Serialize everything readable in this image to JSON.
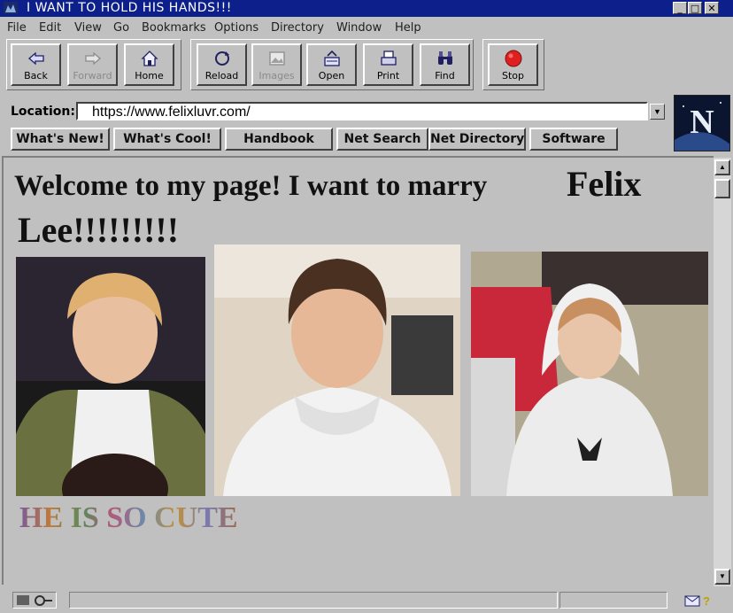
{
  "window": {
    "title": "I WANT TO HOLD HIS HANDS!!!",
    "controls": {
      "minimize": "_",
      "maximize": "□",
      "close": "✕"
    }
  },
  "menu": [
    "File",
    "Edit",
    "View",
    "Go",
    "Bookmarks",
    "Options",
    "Directory",
    "Window",
    "Help"
  ],
  "toolbar": {
    "back": "Back",
    "forward": "Forward",
    "home": "Home",
    "reload": "Reload",
    "images": "Images",
    "open": "Open",
    "print": "Print",
    "find": "Find",
    "stop": "Stop"
  },
  "location": {
    "label": "Location:",
    "url": "https://www.felixluvr.com/"
  },
  "directory_buttons": [
    "What's New!",
    "What's Cool!",
    "Handbook",
    "Net Search",
    "Net Directory",
    "Software"
  ],
  "page": {
    "heading_part1": "Welcome to my page! I want to marry",
    "heading_part2": "Felix",
    "heading_part3": "Lee!!!!!!!!!",
    "tagline": "HE IS SO CUTE"
  },
  "logo": {
    "letter": "N"
  },
  "icons": [
    "netscape-app-icon",
    "back-arrow-icon",
    "forward-arrow-icon",
    "home-icon",
    "reload-icon",
    "images-icon",
    "open-icon",
    "print-icon",
    "find-binoculars-icon",
    "stop-icon",
    "security-key-icon",
    "mail-icon"
  ],
  "colors": {
    "titlebar": "#0c1f8a",
    "chrome": "#c0c0c0",
    "stop_red": "#e02020"
  }
}
